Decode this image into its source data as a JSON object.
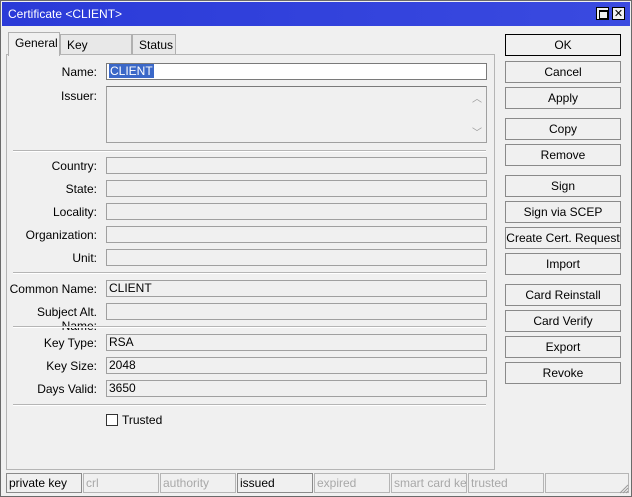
{
  "window": {
    "title": "Certificate <CLIENT>"
  },
  "tabs": [
    "General",
    "Key Usage",
    "Status"
  ],
  "form": {
    "name_label": "Name:",
    "name_value": "CLIENT",
    "issuer_label": "Issuer:",
    "country_label": "Country:",
    "state_label": "State:",
    "locality_label": "Locality:",
    "organization_label": "Organization:",
    "unit_label": "Unit:",
    "common_name_label": "Common Name:",
    "common_name_value": "CLIENT",
    "subject_alt_label": "Subject Alt. Name:",
    "key_type_label": "Key Type:",
    "key_type_value": "RSA",
    "key_size_label": "Key Size:",
    "key_size_value": "2048",
    "days_valid_label": "Days Valid:",
    "days_valid_value": "3650",
    "trusted_label": "Trusted"
  },
  "buttons": [
    "OK",
    "Cancel",
    "Apply",
    "Copy",
    "Remove",
    "Sign",
    "Sign via SCEP",
    "Create Cert. Request",
    "Import",
    "Card Reinstall",
    "Card Verify",
    "Export",
    "Revoke"
  ],
  "status_bar": [
    {
      "label": "private key",
      "active": true
    },
    {
      "label": "crl",
      "active": false
    },
    {
      "label": "authority",
      "active": false
    },
    {
      "label": "issued",
      "active": true
    },
    {
      "label": "expired",
      "active": false
    },
    {
      "label": "smart card key",
      "active": false
    },
    {
      "label": "trusted",
      "active": false
    }
  ]
}
